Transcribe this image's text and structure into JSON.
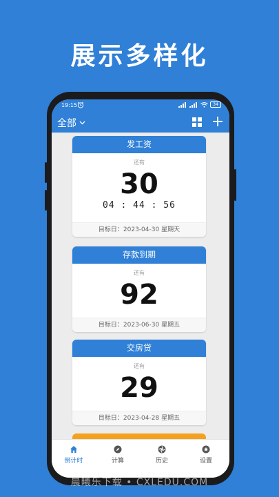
{
  "promo": {
    "title": "展示多样化"
  },
  "status_bar": {
    "time": "19:15",
    "battery": "34"
  },
  "app_bar": {
    "filter_label": "全部"
  },
  "cards": [
    {
      "title": "发工资",
      "subtitle": "还有",
      "days": "30",
      "timer": "04 : 44 : 56",
      "target": "目标日：2023-04-30 星期天"
    },
    {
      "title": "存款到期",
      "subtitle": "还有",
      "days": "92",
      "target": "目标日：2023-06-30 星期五"
    },
    {
      "title": "交房贷",
      "subtitle": "还有",
      "days": "29",
      "target": "目标日：2023-04-28 星期五"
    }
  ],
  "bottom_nav": {
    "items": [
      {
        "label": "倒计时",
        "icon": "home-icon"
      },
      {
        "label": "计算",
        "icon": "compass-icon"
      },
      {
        "label": "历史",
        "icon": "aperture-icon"
      },
      {
        "label": "设置",
        "icon": "star-settings-icon"
      }
    ]
  },
  "watermark": "晨曦乐下载 • CXLEDU.COM",
  "colors": {
    "primary": "#2f80d6",
    "accent": "#f4a11f",
    "background": "#ececec"
  }
}
